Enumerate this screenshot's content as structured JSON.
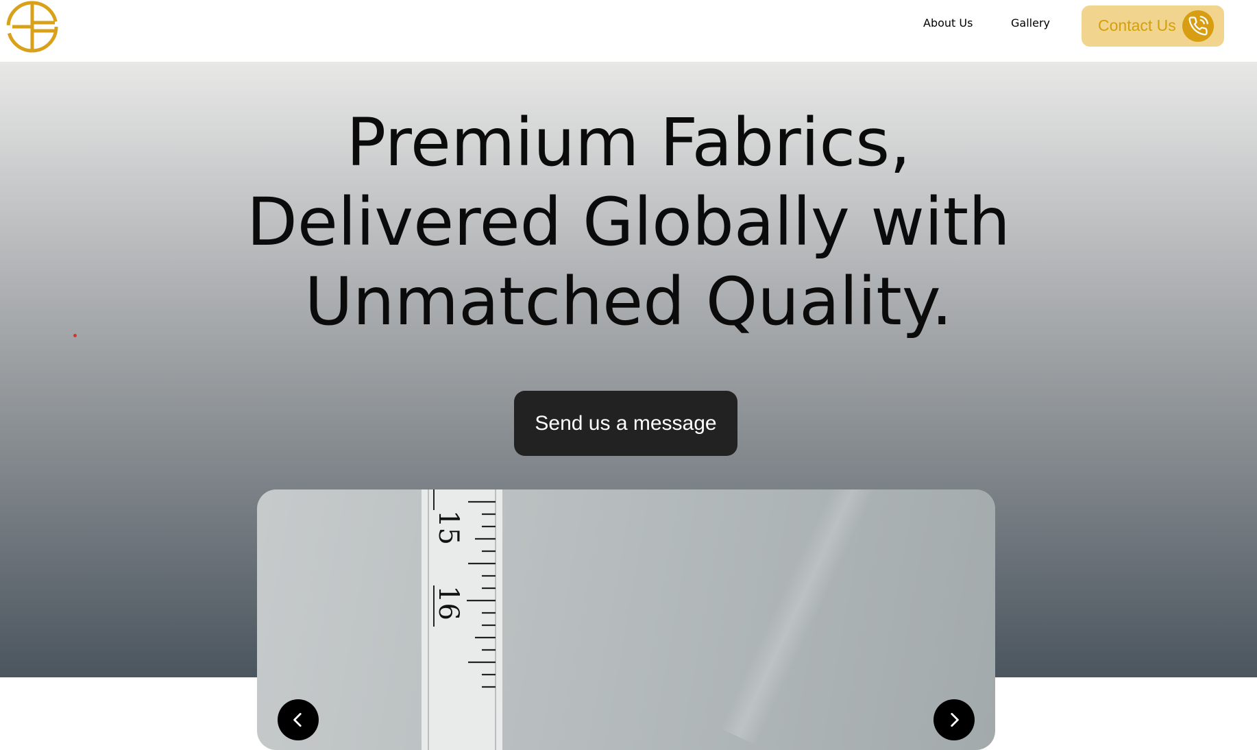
{
  "header": {
    "logo_icon": "monogram-logo",
    "nav": {
      "about_label": "About Us",
      "gallery_label": "Gallery",
      "contact_label": "Contact Us",
      "contact_icon": "phone-icon"
    }
  },
  "hero": {
    "title_line1": "Premium Fabrics,",
    "title_line2": "Delivered Globally with",
    "title_line3": "Unmatched Quality.",
    "cta_label": "Send us a message"
  },
  "carousel": {
    "tape_numbers": [
      "15",
      "16"
    ],
    "prev_icon": "chevron-left-icon",
    "next_icon": "chevron-right-icon"
  },
  "colors": {
    "accent": "#d89e13",
    "accent_light": "#f1d48d",
    "button_dark": "#222222"
  }
}
